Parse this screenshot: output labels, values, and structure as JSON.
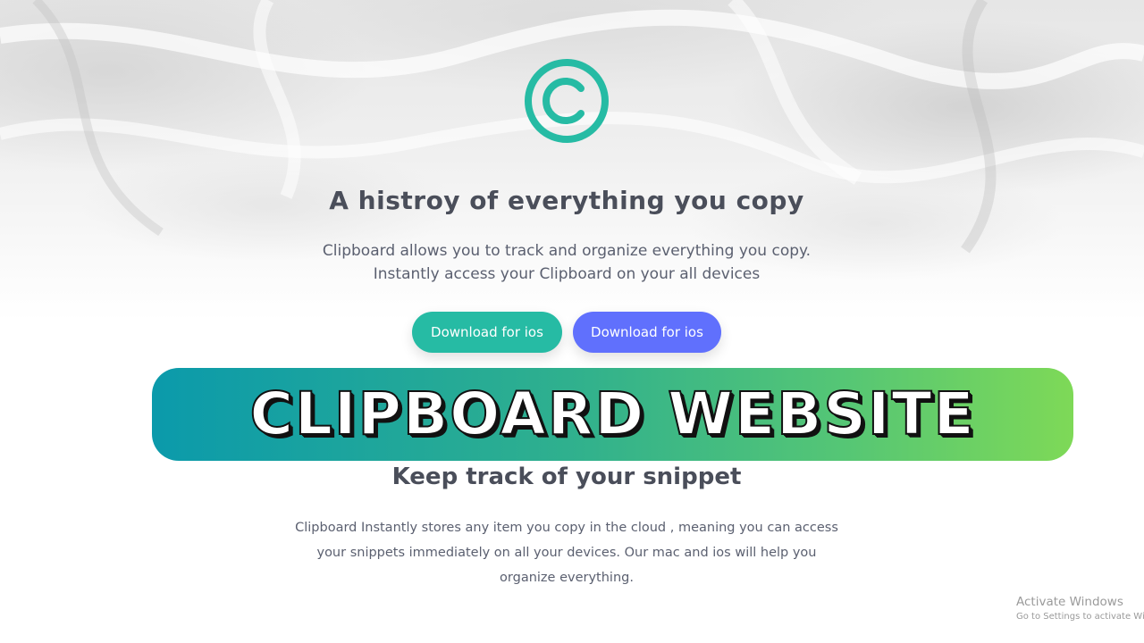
{
  "hero": {
    "logo_icon": "copyright-c-icon",
    "logo_color": "#26bba4",
    "title": "A histroy of everything you copy",
    "description_line1": "Clipboard allows you to track and organize everything you copy.",
    "description_line2": "Instantly access your Clipboard on your all devices",
    "buttons": [
      {
        "label": "Download for ios",
        "color": "#26bba4"
      },
      {
        "label": "Download for ios",
        "color": "#6070fd"
      }
    ]
  },
  "banner": {
    "text": "CLIPBOARD WEBSITE",
    "gradient_start": "#0b9aab",
    "gradient_end": "#7ed957"
  },
  "snippet_section": {
    "title": "Keep track of your snippet",
    "description": "Clipboard Instantly stores any item you copy in the cloud , meaning you can access your snippets immediately on all your devices. Our mac and ios will help you organize everything."
  },
  "os_watermark": {
    "title": "Activate Windows",
    "subtitle": "Go to Settings to activate Windows."
  }
}
